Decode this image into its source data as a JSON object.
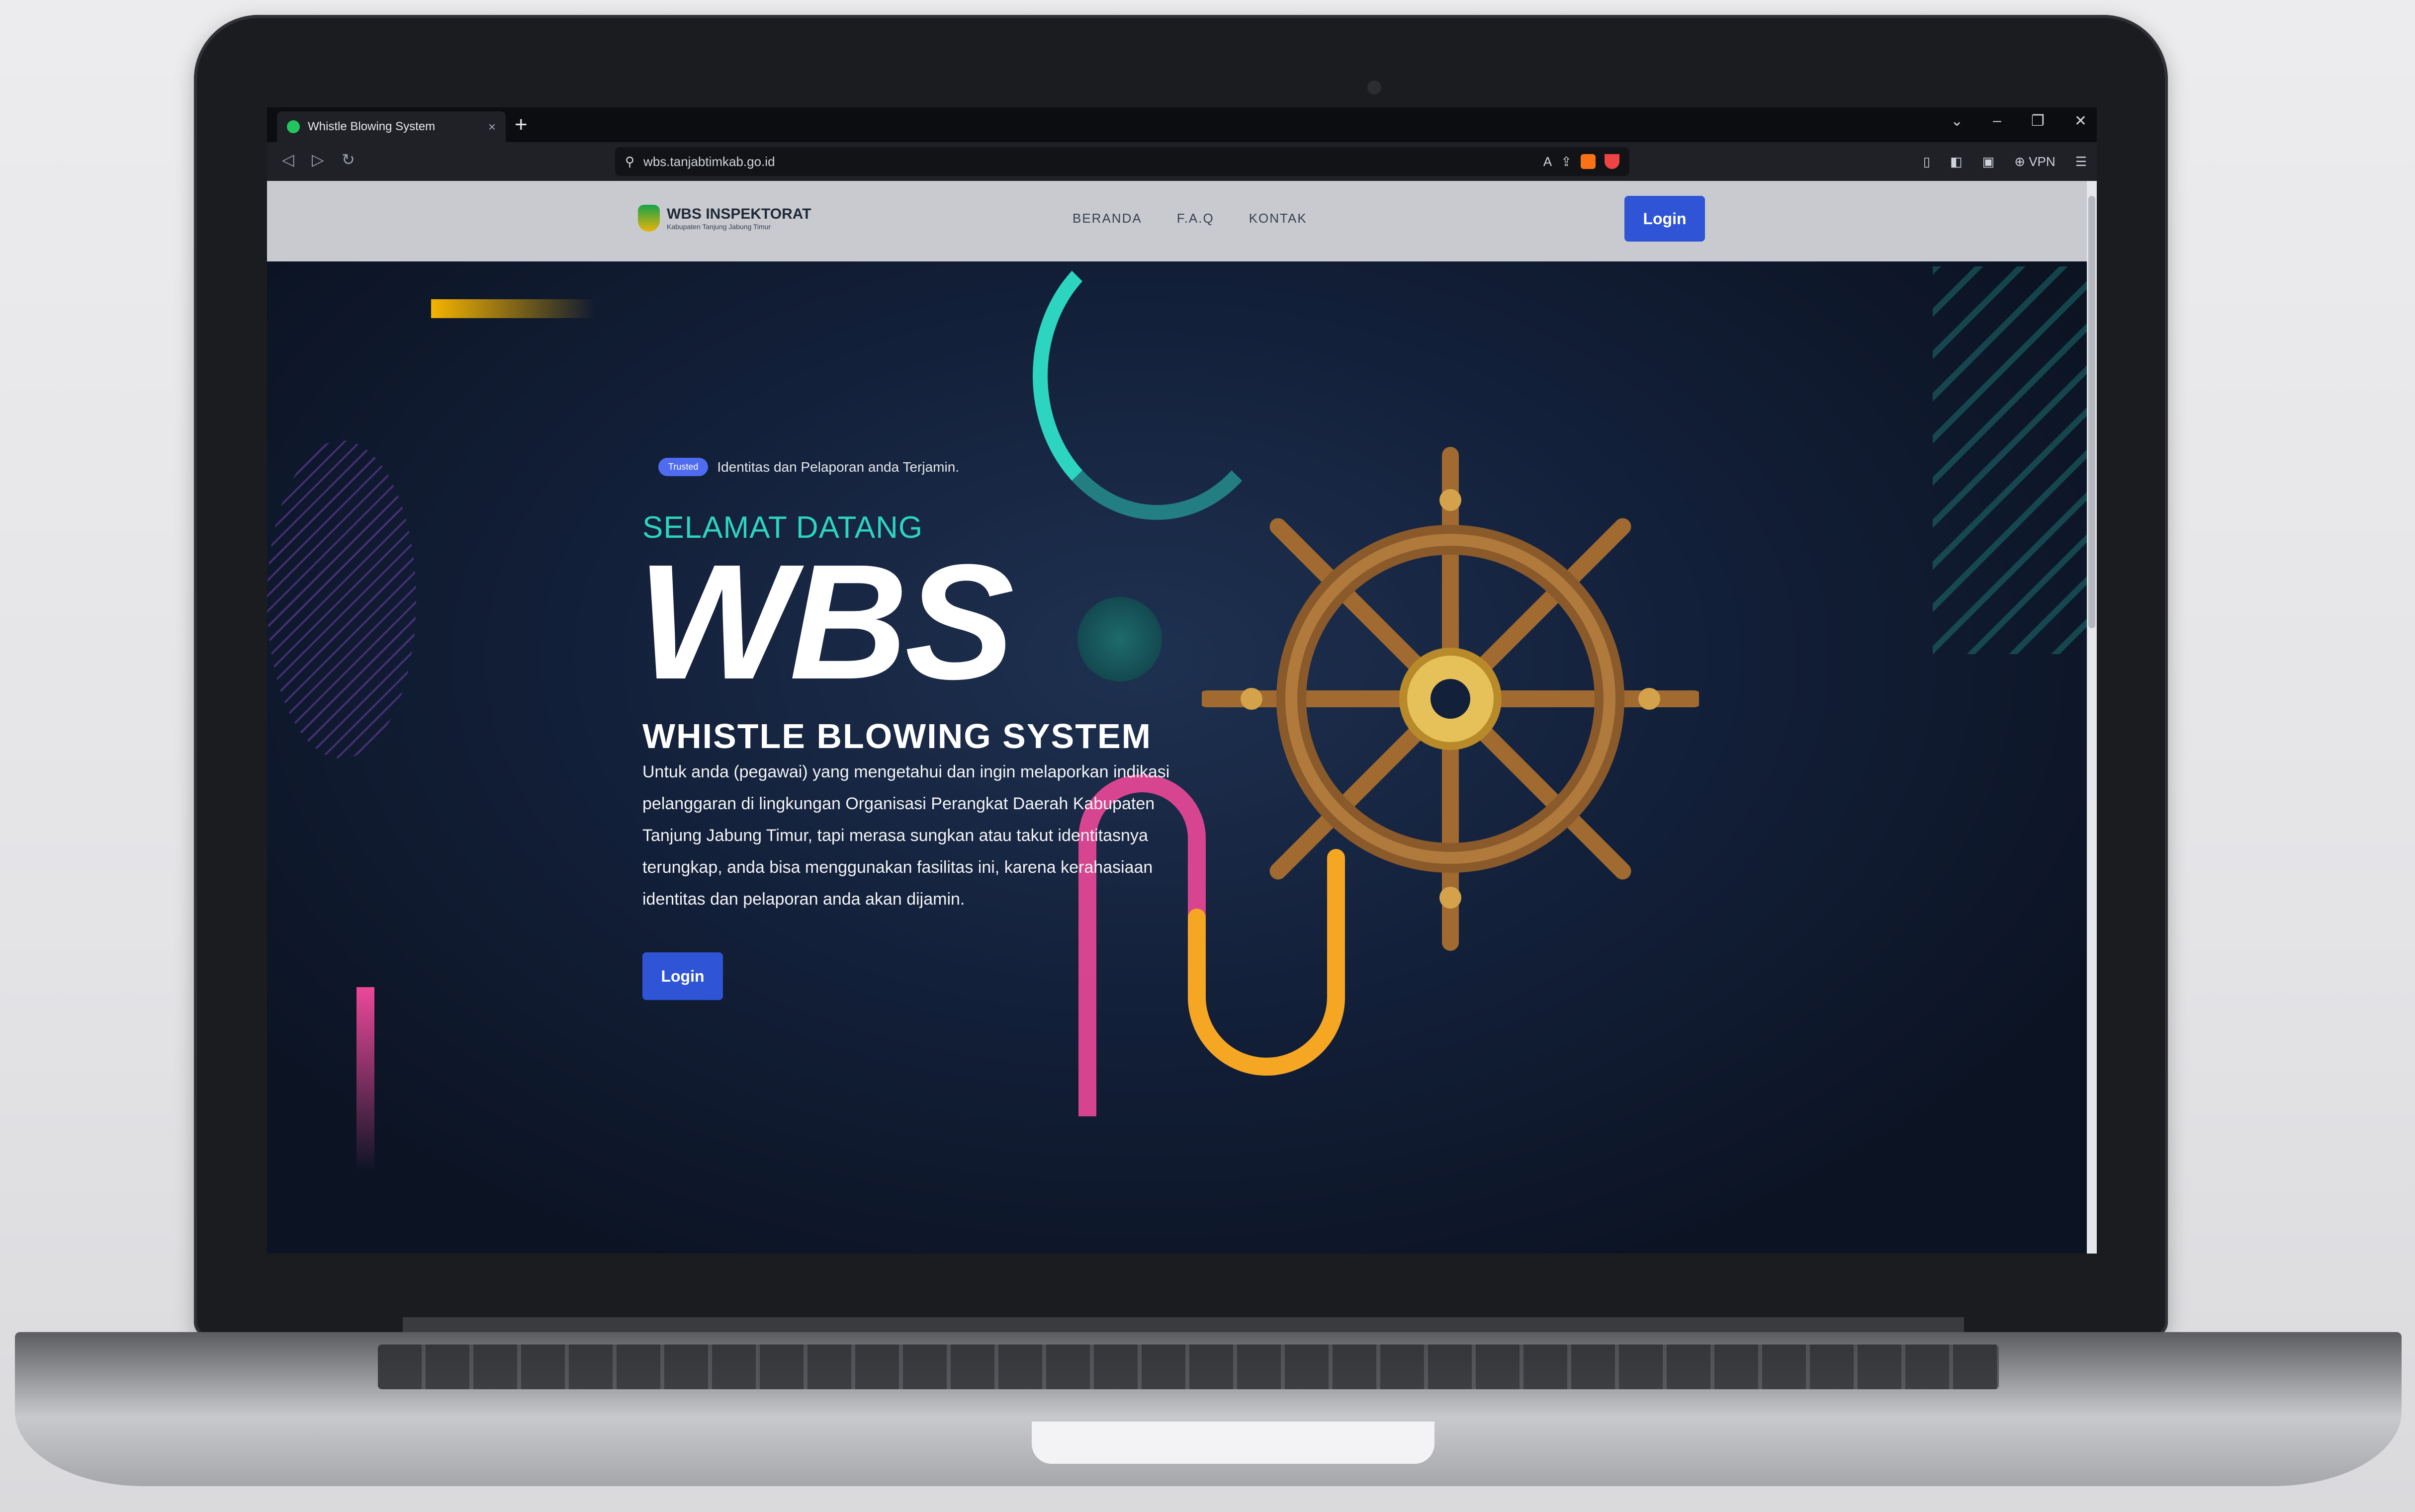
{
  "browser": {
    "tab_title": "Whistle Blowing System",
    "tab_close": "×",
    "new_tab": "+",
    "url": "wbs.tanjabtimkab.go.id",
    "vpn_label": "VPN"
  },
  "site": {
    "logo_title": "WBS INSPEKTORAT",
    "logo_subtitle": "Kabupaten Tanjung Jabung Timur",
    "menu": [
      "BERANDA",
      "F.A.Q",
      "KONTAK"
    ],
    "header_login": "Login"
  },
  "hero": {
    "badge": "Trusted",
    "badge_text": "Identitas dan Pelaporan anda Terjamin.",
    "welcome": "SELAMAT DATANG",
    "headline": "WBS",
    "subtitle": "WHISTLE BLOWING SYSTEM",
    "description": "Untuk anda (pegawai) yang mengetahui dan ingin melaporkan indikasi pelanggaran di lingkungan Organisasi Perangkat Daerah Kabupaten Tanjung Jabung Timur, tapi merasa sungkan atau takut identitasnya terungkap, anda bisa menggunakan fasilitas ini, karena kerahasiaan identitas dan pelaporan anda akan dijamin.",
    "cta_login": "Login"
  },
  "colors": {
    "accent_blue": "#2f54d6",
    "teal": "#2dd4bf",
    "pink": "#ec4899",
    "gold": "#f59e0b",
    "hero_bg": "#13203a",
    "header_bg": "#c9cacf"
  },
  "icons": [
    "shield-favicon-icon",
    "back-icon",
    "forward-icon",
    "reload-icon",
    "bookmark-icon",
    "site-info-icon",
    "translate-icon",
    "share-icon",
    "brave-shield-icon",
    "brave-rewards-icon",
    "sidebar-icon",
    "wallet-icon",
    "menu-icon",
    "ship-wheel-icon"
  ]
}
